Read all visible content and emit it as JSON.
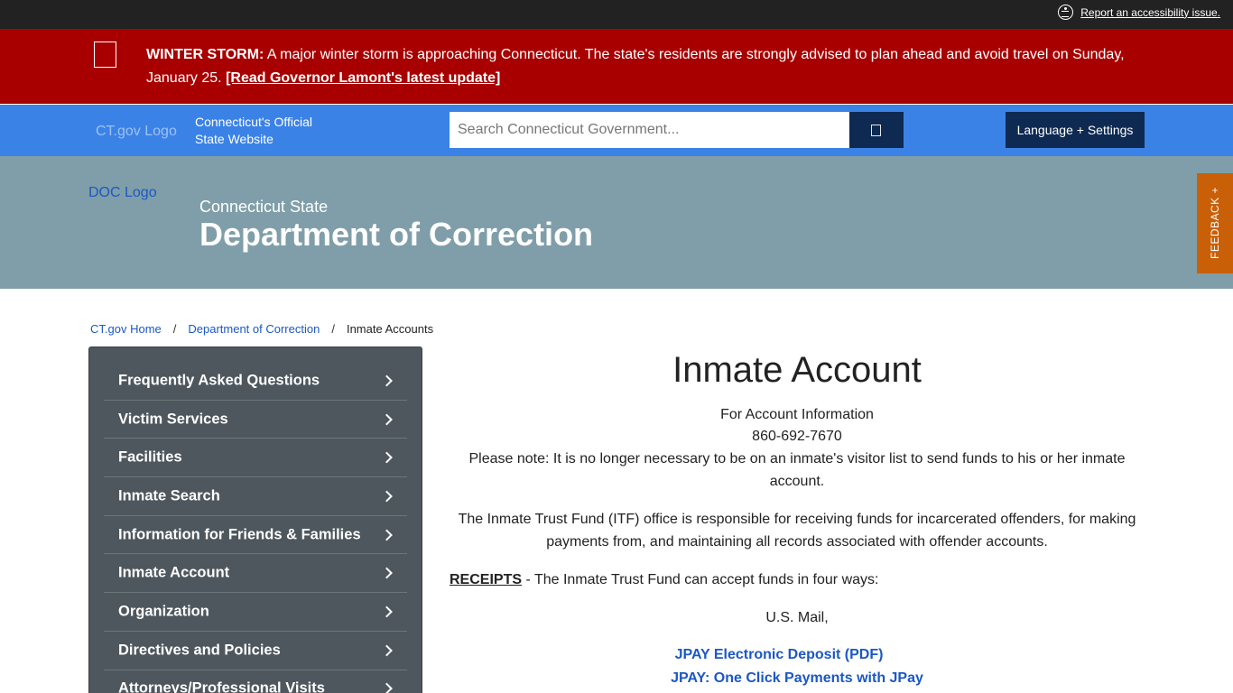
{
  "topbar": {
    "accessibility_icon": "accessibility-icon",
    "accessibility_link": "Report an accessibility issue."
  },
  "alert": {
    "label": "WINTER STORM:",
    "message": " A major winter storm is approaching Connecticut. The state's residents are strongly advised to plan ahead and avoid travel on Sunday, January 25. ",
    "link": "[Read Governor Lamont's latest update]",
    "background_color": "#a80000"
  },
  "header": {
    "logo_alt": "CT.gov Logo",
    "official_line1": "Connecticut's Official",
    "official_line2": "State Website",
    "search_placeholder": "Search Connecticut Government...",
    "search_icon": "search-icon",
    "language_button": "Language + Settings",
    "background_color": "#3b82e6"
  },
  "agency": {
    "logo_alt": "DOC Logo",
    "subtitle": "Connecticut State",
    "title": "Department of Correction"
  },
  "feedback": {
    "label": "FEEDBACK +"
  },
  "breadcrumb": {
    "home": "CT.gov Home",
    "separator": "/",
    "department": "Department of Correction",
    "current": "Inmate Accounts"
  },
  "sidebar": {
    "items": [
      {
        "label": "Frequently Asked Questions"
      },
      {
        "label": "Victim Services"
      },
      {
        "label": "Facilities"
      },
      {
        "label": "Inmate Search"
      },
      {
        "label": "Information for Friends & Families"
      },
      {
        "label": "Inmate Account"
      },
      {
        "label": "Organization"
      },
      {
        "label": "Directives and Policies"
      },
      {
        "label": "Attorneys/Professional Visits"
      }
    ]
  },
  "main": {
    "title": "Inmate Account",
    "info_label": "For Account Information",
    "phone": "860-692-7670",
    "note": "Please note: It is no longer necessary to be on an inmate's visitor list to send funds to his or her inmate account.",
    "itf_paragraph": "The Inmate Trust Fund (ITF) office is responsible for receiving funds for incarcerated offenders, for making payments from, and maintaining all records associated with offender accounts.",
    "receipts_label": "RECEIPTS",
    "receipts_text": " - The Inmate Trust Fund can accept funds in four ways:",
    "mail": "U.S. Mail,",
    "link1": "JPAY Electronic Deposit (PDF)",
    "link2": "JPAY: One Click Payments with JPay"
  }
}
